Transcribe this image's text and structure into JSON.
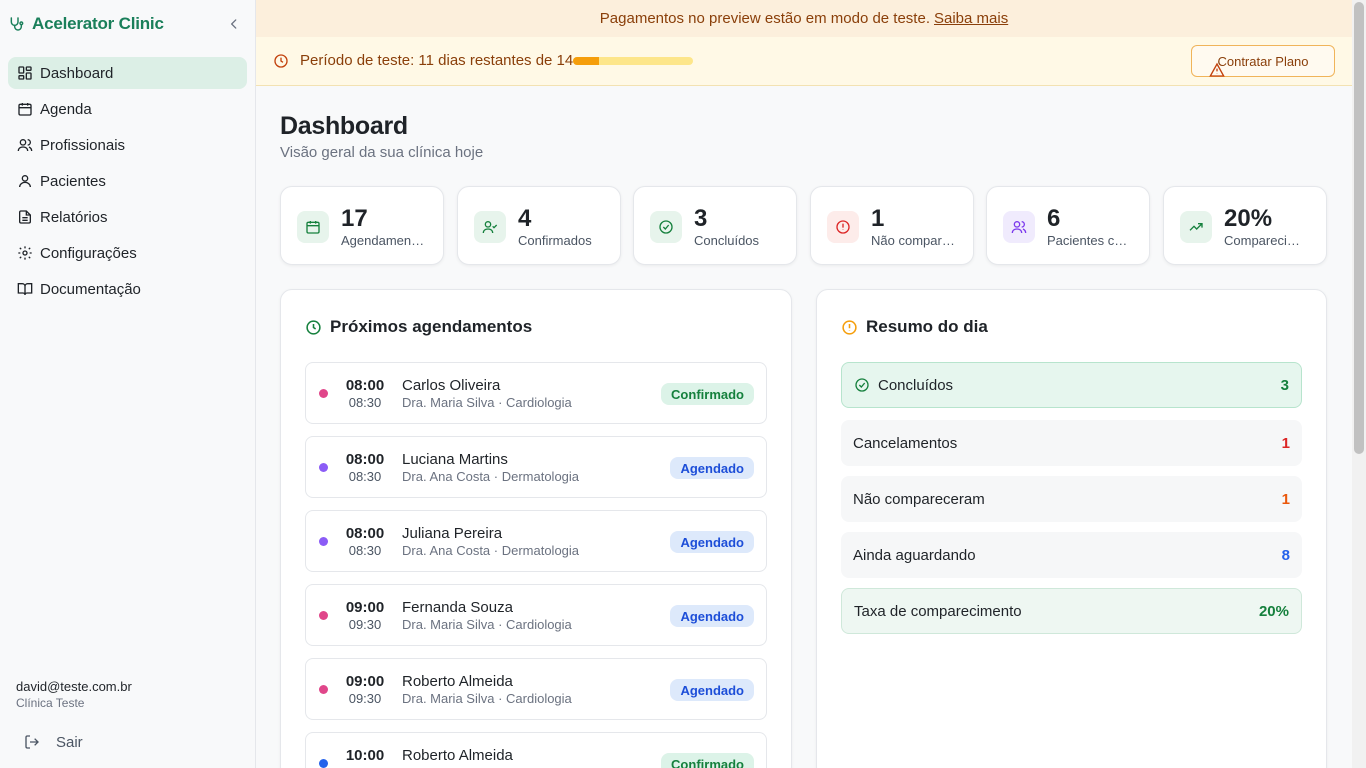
{
  "brand": {
    "name": "Acelerator Clinic",
    "icon": "stethoscope-icon"
  },
  "sidebar": {
    "items": [
      {
        "label": "Dashboard",
        "icon": "layout-dashboard-icon",
        "active": true
      },
      {
        "label": "Agenda",
        "icon": "calendar-icon"
      },
      {
        "label": "Profissionais",
        "icon": "users-icon"
      },
      {
        "label": "Pacientes",
        "icon": "user-icon"
      },
      {
        "label": "Relatórios",
        "icon": "file-text-icon"
      },
      {
        "label": "Configurações",
        "icon": "gear-icon"
      },
      {
        "label": "Documentação",
        "icon": "book-open-icon"
      }
    ],
    "user_email": "david@teste.com.br",
    "clinic_name": "Clínica Teste",
    "logout_label": "Sair"
  },
  "banner": {
    "test_text": "Pagamentos no preview estão em modo de teste.",
    "test_link": "Saiba mais",
    "trial_text": "Período de teste: 11 dias restantes de 14",
    "trial_progress": 0.214,
    "plan_button": "Contratar Plano"
  },
  "header": {
    "title": "Dashboard",
    "subtitle": "Visão geral da sua clínica hoje"
  },
  "stats": [
    {
      "value": "17",
      "label": "Agendamentos",
      "icon": "calendar-icon",
      "color": "#15803d",
      "bg": "#e7f4ec"
    },
    {
      "value": "4",
      "label": "Confirmados",
      "icon": "user-check-icon",
      "color": "#15803d",
      "bg": "#e7f4ec"
    },
    {
      "value": "3",
      "label": "Concluídos",
      "icon": "check-circle-icon",
      "color": "#15803d",
      "bg": "#e7f4ec"
    },
    {
      "value": "1",
      "label": "Não compareceram",
      "icon": "alert-circle-icon",
      "color": "#dc2626",
      "bg": "#fdecea"
    },
    {
      "value": "6",
      "label": "Pacientes cadastrados",
      "icon": "users-icon",
      "color": "#7c3aed",
      "bg": "#f0ebfd"
    },
    {
      "value": "20%",
      "label": "Comparecimento",
      "icon": "trending-up-icon",
      "color": "#15803d",
      "bg": "#e7f4ec"
    }
  ],
  "appointments": {
    "title": "Próximos agendamentos",
    "items": [
      {
        "start": "08:00",
        "end": "08:30",
        "patient": "Carlos Oliveira",
        "info": "Dra. Maria Silva · Cardiologia",
        "status": "Confirmado",
        "kind": "confirmed",
        "dot": "#e0468a"
      },
      {
        "start": "08:00",
        "end": "08:30",
        "patient": "Luciana Martins",
        "info": "Dra. Ana Costa · Dermatologia",
        "status": "Agendado",
        "kind": "scheduled",
        "dot": "#8b5cf6"
      },
      {
        "start": "08:00",
        "end": "08:30",
        "patient": "Juliana Pereira",
        "info": "Dra. Ana Costa · Dermatologia",
        "status": "Agendado",
        "kind": "scheduled",
        "dot": "#8b5cf6"
      },
      {
        "start": "09:00",
        "end": "09:30",
        "patient": "Fernanda Souza",
        "info": "Dra. Maria Silva · Cardiologia",
        "status": "Agendado",
        "kind": "scheduled",
        "dot": "#e0468a"
      },
      {
        "start": "09:00",
        "end": "09:30",
        "patient": "Roberto Almeida",
        "info": "Dra. Maria Silva · Cardiologia",
        "status": "Agendado",
        "kind": "scheduled",
        "dot": "#e0468a"
      },
      {
        "start": "10:00",
        "end": "",
        "patient": "Roberto Almeida",
        "info": "",
        "status": "Confirmado",
        "kind": "confirmed",
        "dot": "#2563eb"
      }
    ]
  },
  "summary": {
    "title": "Resumo do dia",
    "rows": [
      {
        "label": "Concluídos",
        "value": "3",
        "color": "#15803d",
        "style": "green",
        "icon": "check-circle-icon"
      },
      {
        "label": "Cancelamentos",
        "value": "1",
        "color": "#dc2626",
        "style": "plain"
      },
      {
        "label": "Não compareceram",
        "value": "1",
        "color": "#ea580c",
        "style": "plain"
      },
      {
        "label": "Ainda aguardando",
        "value": "8",
        "color": "#2563eb",
        "style": "plain"
      },
      {
        "label": "Taxa de comparecimento",
        "value": "20%",
        "color": "#15803d",
        "style": "rate"
      }
    ]
  }
}
